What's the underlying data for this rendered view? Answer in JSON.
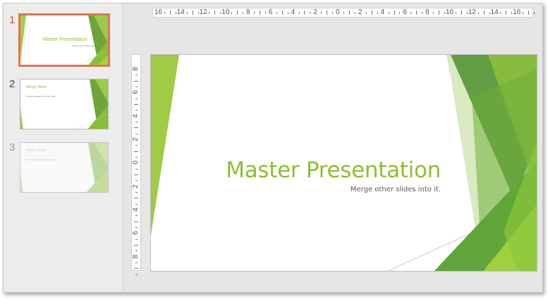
{
  "thumbnails": [
    {
      "number": "1",
      "title": "Master Presentation",
      "subtitle": "Merge other slides into it.",
      "selected": true
    },
    {
      "number": "2",
      "title": "Merge Slides",
      "subtitle": "Combine slides from other files",
      "selected": false
    },
    {
      "number": "3",
      "title": "Hidden Slide",
      "subtitle": "This slide is hidden in the show",
      "selected": false,
      "hidden": true
    }
  ],
  "ruler": {
    "horizontal_labels": [
      "16",
      "14",
      "12",
      "10",
      "8",
      "6",
      "4",
      "2",
      "0",
      "2",
      "4",
      "6",
      "8",
      "10",
      "12",
      "14",
      "16"
    ],
    "vertical_labels": [
      "8",
      "6",
      "4",
      "2",
      "0",
      "2",
      "4",
      "6",
      "8"
    ]
  },
  "slide": {
    "title": "Master Presentation",
    "subtitle": "Merge other slides into it."
  },
  "colors": {
    "accent_green": "#8dbf2f",
    "dark_green": "#5f9a2e",
    "light_green": "#c9e29a",
    "selection": "#e07650"
  }
}
